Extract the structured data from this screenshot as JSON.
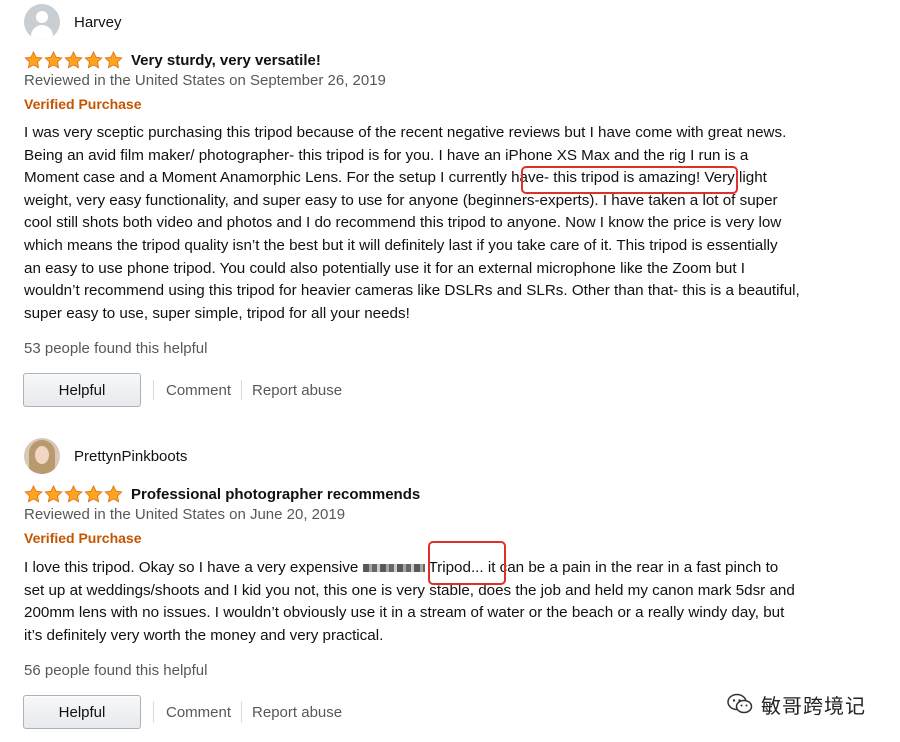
{
  "colors": {
    "star": "#ffa41c",
    "star_outline": "#de7921",
    "verified": "#c45500",
    "muted": "#565959",
    "highlight_box": "#e0302d"
  },
  "reviews": [
    {
      "username": "Harvey",
      "avatar": "default-avatar-icon",
      "rating": 5,
      "title": "Very sturdy, very versatile!",
      "meta": "Reviewed in the United States on September 26, 2019",
      "verified": "Verified Purchase",
      "body_lines": [
        "I was very sceptic purchasing this tripod because of the recent negative reviews but I have come with great news.",
        "Being an avid film maker/ photographer- this tripod is for you. I have an iPhone XS Max and the rig I run is a",
        "Moment case and a Moment Anamorphic Lens. For the setup I currently have- this tripod is amazing! Very light",
        "weight, very easy functionality, and super easy to use for anyone (beginners-experts). I have taken a lot of super",
        "cool still shots both video and photos and I do recommend this tripod to anyone. Now I know the price is very low",
        "which means the tripod quality isn’t the best but it will definitely last if you take care of it. This tripod is essentially",
        "an easy to use phone tripod. You could also potentially use it for an external microphone like the Zoom but I",
        "wouldn’t recommend using this tripod for heavier cameras like DSLRs and SLRs. Other than that- this is a beautiful,",
        "super easy to use, super simple, tripod for all your needs!"
      ],
      "helpful_count": "53 people found this helpful",
      "helpful_button": "Helpful",
      "comment": "Comment",
      "report": "Report abuse"
    },
    {
      "username": "PrettynPinkboots",
      "avatar": "profile-photo-avatar",
      "rating": 5,
      "title": "Professional photographer recommends",
      "meta": "Reviewed in the United States on June 20, 2019",
      "verified": "Verified Purchase",
      "body_line1_before": "I love this tripod. Okay so I have a very expensive ",
      "body_line1_after": " Tripod... it can be a pain in the rear in a fast pinch to",
      "body_lines_rest": [
        "set up at weddings/shoots and I kid you not, this one is very stable, does the job and held my canon mark 5dsr and",
        "200mm lens with no issues. I wouldn’t obviously use it in a stream of water or the beach or a really windy day, but",
        "it’s definitely very worth the money and very practical."
      ],
      "helpful_count": "56 people found this helpful",
      "helpful_button": "Helpful",
      "comment": "Comment",
      "report": "Report abuse"
    }
  ],
  "watermark": {
    "icon": "wechat-icon",
    "text": "敏哥跨境记"
  }
}
